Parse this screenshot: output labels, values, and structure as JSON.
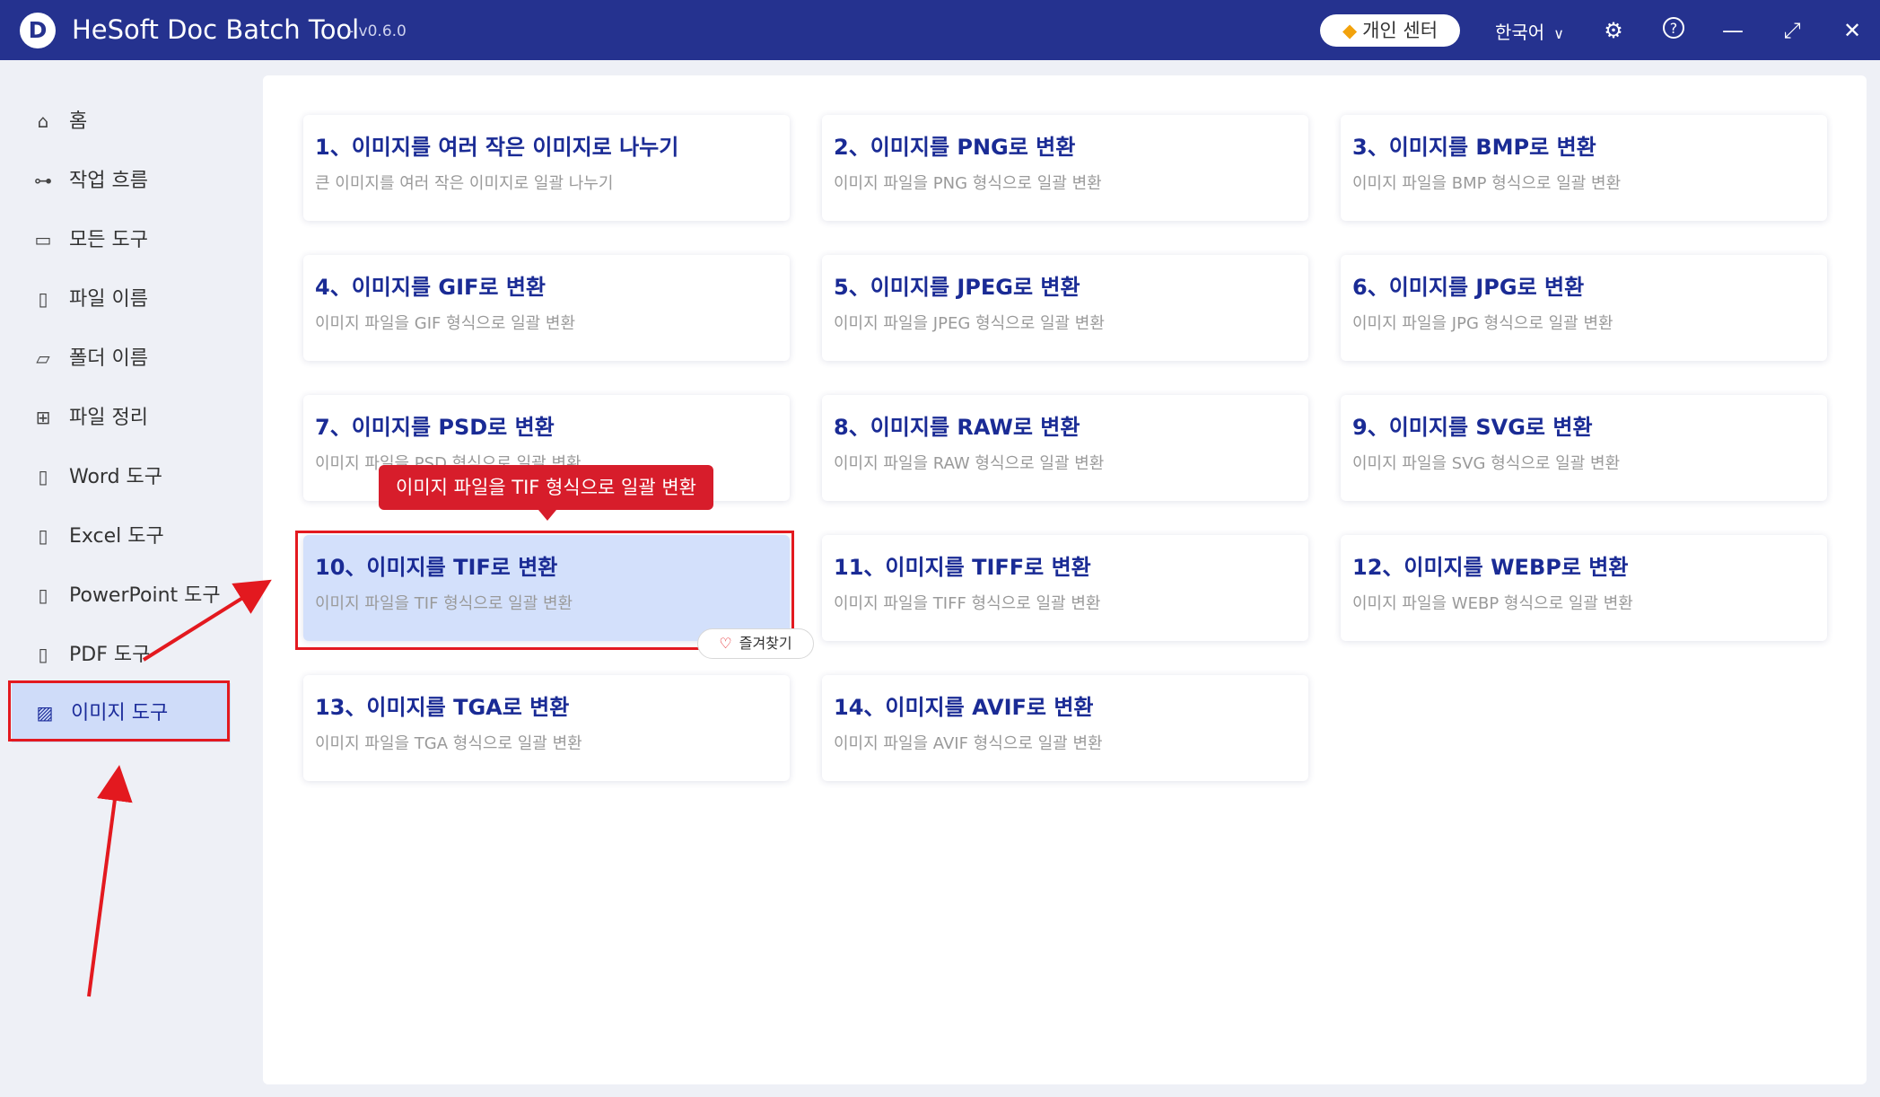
{
  "app": {
    "title": "HeSoft Doc Batch Tool",
    "version": "- v0.6.0",
    "logo_letter": "D"
  },
  "header": {
    "personal_center": "개인 센터",
    "language": "한국어"
  },
  "sidebar": {
    "items": [
      {
        "label": "홈",
        "icon": "home-icon"
      },
      {
        "label": "작업 흐름",
        "icon": "workflow-icon"
      },
      {
        "label": "모든 도구",
        "icon": "monitor-icon"
      },
      {
        "label": "파일 이름",
        "icon": "file-icon"
      },
      {
        "label": "폴더 이름",
        "icon": "folder-icon"
      },
      {
        "label": "파일 정리",
        "icon": "organize-icon"
      },
      {
        "label": "Word 도구",
        "icon": "word-icon"
      },
      {
        "label": "Excel 도구",
        "icon": "excel-icon"
      },
      {
        "label": "PowerPoint 도구",
        "icon": "powerpoint-icon"
      },
      {
        "label": "PDF 도구",
        "icon": "pdf-icon"
      },
      {
        "label": "이미지 도구",
        "icon": "image-icon",
        "active": true
      }
    ]
  },
  "cards": [
    {
      "title": "1、이미지를 여러 작은 이미지로 나누기",
      "desc": "큰 이미지를 여러 작은 이미지로 일괄 나누기"
    },
    {
      "title": "2、이미지를 PNG로 변환",
      "desc": "이미지 파일을 PNG 형식으로 일괄 변환"
    },
    {
      "title": "3、이미지를 BMP로 변환",
      "desc": "이미지 파일을 BMP 형식으로 일괄 변환"
    },
    {
      "title": "4、이미지를 GIF로 변환",
      "desc": "이미지 파일을 GIF 형식으로 일괄 변환"
    },
    {
      "title": "5、이미지를 JPEG로 변환",
      "desc": "이미지 파일을 JPEG 형식으로 일괄 변환"
    },
    {
      "title": "6、이미지를 JPG로 변환",
      "desc": "이미지 파일을 JPG 형식으로 일괄 변환"
    },
    {
      "title": "7、이미지를 PSD로 변환",
      "desc": "이미지 파일을 PSD 형식으로 일괄 변환"
    },
    {
      "title": "8、이미지를 RAW로 변환",
      "desc": "이미지 파일을 RAW 형식으로 일괄 변환"
    },
    {
      "title": "9、이미지를 SVG로 변환",
      "desc": "이미지 파일을 SVG 형식으로 일괄 변환"
    },
    {
      "title": "10、이미지를 TIF로 변환",
      "desc": "이미지 파일을 TIF 형식으로 일괄 변환",
      "selected": true
    },
    {
      "title": "11、이미지를 TIFF로 변환",
      "desc": "이미지 파일을 TIFF 형식으로 일괄 변환"
    },
    {
      "title": "12、이미지를 WEBP로 변환",
      "desc": "이미지 파일을 WEBP 형식으로 일괄 변환"
    },
    {
      "title": "13、이미지를 TGA로 변환",
      "desc": "이미지 파일을 TGA 형식으로 일괄 변환"
    },
    {
      "title": "14、이미지를 AVIF로 변환",
      "desc": "이미지 파일을 AVIF 형식으로 일괄 변환"
    }
  ],
  "tooltip": "이미지 파일을 TIF 형식으로 일괄 변환",
  "favorite_label": "즐겨찾기",
  "colors": {
    "titlebar": "#25328f",
    "accent": "#1a2b95",
    "highlight": "#e3191f",
    "selected_card": "#d3e0fb"
  }
}
